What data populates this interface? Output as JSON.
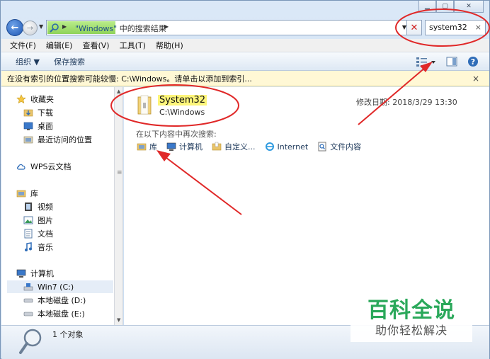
{
  "window": {
    "caption_buttons": [
      "minimize",
      "maximize",
      "close"
    ]
  },
  "address": {
    "part1": "\"Windows\"",
    "part2": "中的搜索结果",
    "search_value": "system32",
    "search_clear": "×"
  },
  "menu": [
    "文件(F)",
    "编辑(E)",
    "查看(V)",
    "工具(T)",
    "帮助(H)"
  ],
  "toolbar": {
    "organize": "组织 ▼",
    "save_search": "保存搜索"
  },
  "infobar": {
    "text": "在没有索引的位置搜索可能较慢: C:\\Windows。请单击以添加到索引...",
    "close": "×"
  },
  "nav": {
    "favorites": "收藏夹",
    "downloads": "下载",
    "desktop": "桌面",
    "recent": "最近访问的位置",
    "wps": "WPS云文档",
    "libraries": "库",
    "videos": "视频",
    "pictures": "图片",
    "documents": "文档",
    "music": "音乐",
    "computer": "计算机",
    "drive_c": "Win7 (C:)",
    "drive_d": "本地磁盘 (D:)",
    "drive_e": "本地磁盘 (E:)"
  },
  "result": {
    "name": "System32",
    "path": "C:\\Windows",
    "modified": "修改日期: 2018/3/29 13:30"
  },
  "research": {
    "label": "在以下内容中再次搜索:",
    "links": [
      "库",
      "计算机",
      "自定义...",
      "Internet",
      "文件内容"
    ]
  },
  "status": {
    "text": "1 个对象"
  },
  "watermark": {
    "title": "百科全说",
    "subtitle": "助你轻松解决"
  },
  "colors": {
    "annotation": "#e02828",
    "watermark_green": "#2aa85a",
    "highlight": "#fdf57a"
  }
}
